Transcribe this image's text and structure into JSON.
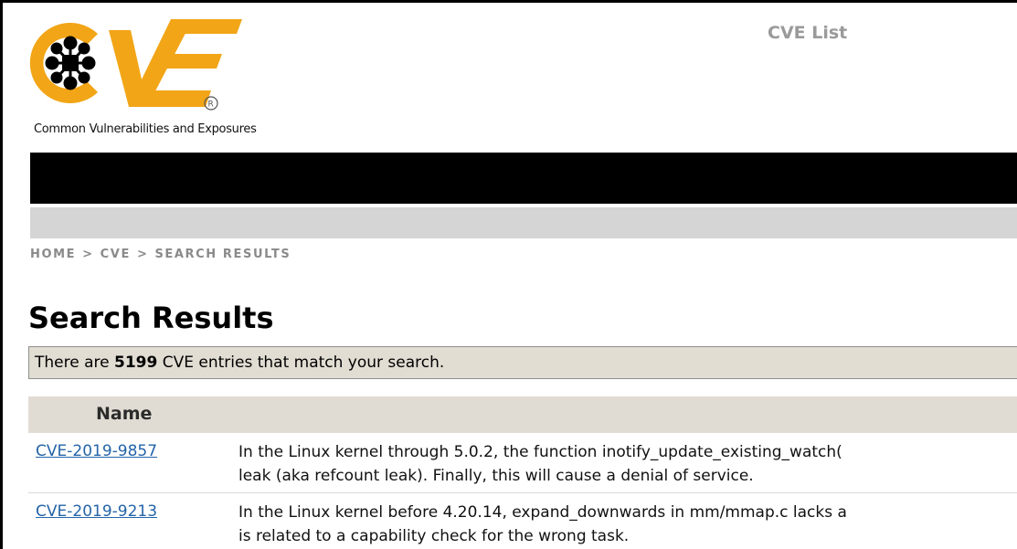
{
  "header": {
    "site_title": "CVE List",
    "logo_text": "CVE",
    "logo_tagline": "Common Vulnerabilities and Exposures",
    "colors": {
      "logo_orange": "#f2a516",
      "logo_black": "#000000",
      "nav_bar": "#000000",
      "sub_bar": "#d5d5d5"
    }
  },
  "breadcrumb": {
    "items": [
      "HOME",
      "CVE",
      "SEARCH RESULTS"
    ],
    "separator": ">"
  },
  "page_title": "Search Results",
  "notice": {
    "prefix": "There are ",
    "count": "5199",
    "suffix": " CVE entries that match your search."
  },
  "table": {
    "headers": {
      "name": "Name"
    },
    "rows": [
      {
        "id": "CVE-2019-9857",
        "desc_line1": "In the Linux kernel through 5.0.2, the function inotify_update_existing_watch(",
        "desc_line2": "leak (aka refcount leak). Finally, this will cause a denial of service."
      },
      {
        "id": "CVE-2019-9213",
        "desc_line1": "In the Linux kernel before 4.20.14, expand_downwards in mm/mmap.c lacks a",
        "desc_line2": "is related to a capability check for the wrong task."
      }
    ],
    "colors": {
      "link": "#2464a8",
      "header_bg": "#e0dcd3"
    }
  }
}
